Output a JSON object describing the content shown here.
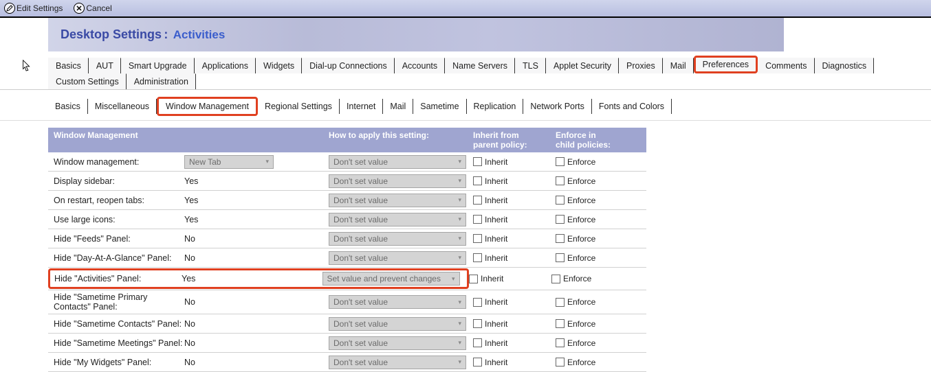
{
  "toolbar": {
    "edit_label": "Edit Settings",
    "cancel_label": "Cancel"
  },
  "banner": {
    "title": "Desktop Settings",
    "sep": ":",
    "subtitle": "Activities"
  },
  "tabs1": [
    "Basics",
    "AUT",
    "Smart Upgrade",
    "Applications",
    "Widgets",
    "Dial-up Connections",
    "Accounts",
    "Name Servers",
    "TLS",
    "Applet Security",
    "Proxies",
    "Mail",
    "Preferences",
    "Comments",
    "Diagnostics",
    "Custom Settings",
    "Administration"
  ],
  "tabs1_highlight_index": 12,
  "tabs2": [
    "Basics",
    "Miscellaneous",
    "Window Management",
    "Regional Settings",
    "Internet",
    "Mail",
    "Sametime",
    "Replication",
    "Network Ports",
    "Fonts and Colors"
  ],
  "tabs2_highlight_index": 2,
  "header": {
    "c1": "Window Management",
    "c2": "How to apply this setting:",
    "c3a": "Inherit from",
    "c3b": "parent policy:",
    "c4a": "Enforce in",
    "c4b": "child policies:"
  },
  "labels": {
    "inherit": "Inherit",
    "enforce": "Enforce"
  },
  "rows": [
    {
      "label": "Window management:",
      "value_is_dropdown": true,
      "value": "New Tab",
      "apply": "Don't set value",
      "hl": false
    },
    {
      "label": "Display sidebar:",
      "value": "Yes",
      "apply": "Don't set value",
      "hl": false
    },
    {
      "label": "On restart, reopen tabs:",
      "value": "Yes",
      "apply": "Don't set value",
      "hl": false
    },
    {
      "label": "Use large icons:",
      "value": "Yes",
      "apply": "Don't set value",
      "hl": false
    },
    {
      "label": "Hide \"Feeds\" Panel:",
      "value": "No",
      "apply": "Don't set value",
      "hl": false
    },
    {
      "label": "Hide \"Day-At-A-Glance\" Panel:",
      "value": "No",
      "apply": "Don't set value",
      "hl": false
    },
    {
      "label": "Hide \"Activities\" Panel:",
      "value": "Yes",
      "apply": "Set value and prevent changes",
      "hl": true
    },
    {
      "label": "Hide \"Sametime Primary Contacts\" Panel:",
      "value": "No",
      "apply": "Don't set value",
      "hl": false
    },
    {
      "label": "Hide \"Sametime Contacts\" Panel:",
      "value": "No",
      "apply": "Don't set value",
      "hl": false
    },
    {
      "label": "Hide \"Sametime Meetings\" Panel:",
      "value": "No",
      "apply": "Don't set value",
      "hl": false
    },
    {
      "label": "Hide \"My Widgets\" Panel:",
      "value": "No",
      "apply": "Don't set value",
      "hl": false
    }
  ]
}
